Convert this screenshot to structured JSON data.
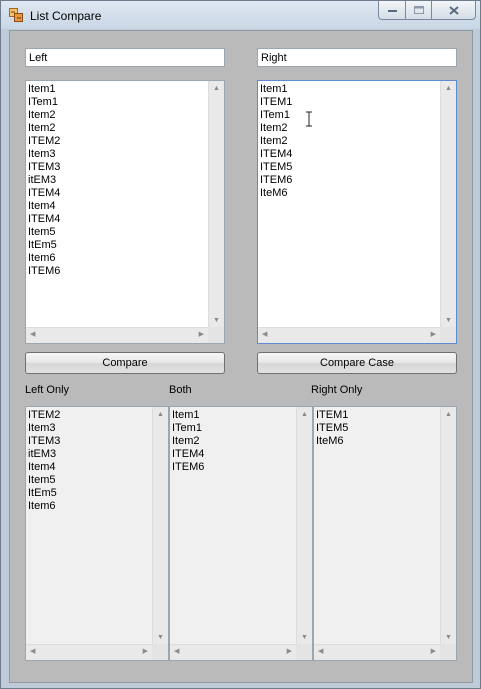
{
  "window": {
    "title": "List Compare",
    "icon": "list-compare-app-icon",
    "caption_buttons": [
      "minimize-icon",
      "maximize-icon",
      "close-icon"
    ]
  },
  "left_input": {
    "value": "Left"
  },
  "right_input": {
    "value": "Right"
  },
  "left_list": {
    "items": [
      "Item1",
      "ITem1",
      "Item2",
      "Item2",
      "ITEM2",
      "Item3",
      "ITEM3",
      "itEM3",
      "ITEM4",
      "Item4",
      "ITEM4",
      "Item5",
      "ItEm5",
      "Item6",
      "ITEM6"
    ]
  },
  "right_list": {
    "items": [
      "Item1",
      "ITEM1",
      "ITem1",
      "Item2",
      "Item2",
      "ITEM4",
      "ITEM5",
      "ITEM6",
      "IteM6"
    ]
  },
  "buttons": {
    "compare": "Compare",
    "compare_case": "Compare Case"
  },
  "results": {
    "left_only": {
      "label": "Left Only",
      "items": [
        "ITEM2",
        "Item3",
        "ITEM3",
        "itEM3",
        "Item4",
        "Item5",
        "ItEm5",
        "Item6"
      ]
    },
    "both": {
      "label": "Both",
      "items": [
        "Item1",
        "ITem1",
        "Item2",
        "ITEM4",
        "ITEM6"
      ]
    },
    "right_only": {
      "label": "Right Only",
      "items": [
        "ITEM1",
        "ITEM5",
        "IteM6"
      ]
    }
  },
  "colors": {
    "client_bg": "#bababa",
    "chrome_bg": "#bfcbd9",
    "readonly_list_bg": "#f0f0f0"
  }
}
